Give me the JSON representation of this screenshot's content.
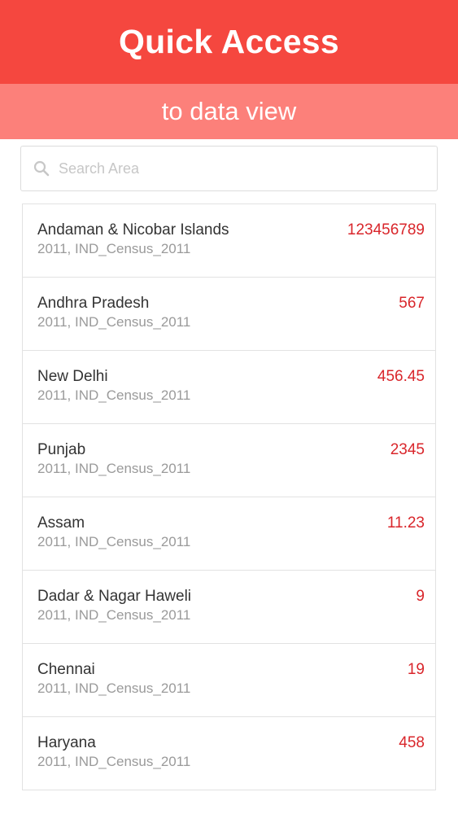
{
  "header": {
    "title": "Quick Access",
    "subtitle": "to data view"
  },
  "search": {
    "placeholder": "Search Area",
    "value": ""
  },
  "items": [
    {
      "name": "Andaman & Nicobar Islands",
      "meta": "2011, IND_Census_2011",
      "value": "123456789"
    },
    {
      "name": "Andhra Pradesh",
      "meta": "2011, IND_Census_2011",
      "value": "567"
    },
    {
      "name": "New Delhi",
      "meta": "2011, IND_Census_2011",
      "value": "456.45"
    },
    {
      "name": "Punjab",
      "meta": "2011, IND_Census_2011",
      "value": "2345"
    },
    {
      "name": "Assam",
      "meta": "2011, IND_Census_2011",
      "value": "11.23"
    },
    {
      "name": "Dadar & Nagar Haweli",
      "meta": "2011, IND_Census_2011",
      "value": "9"
    },
    {
      "name": "Chennai",
      "meta": "2011, IND_Census_2011",
      "value": "19"
    },
    {
      "name": "Haryana",
      "meta": "2011, IND_Census_2011",
      "value": "458"
    }
  ],
  "colors": {
    "header": "#f5473f",
    "subheader": "#fc807a",
    "value": "#d9262b"
  },
  "icons": {
    "search": "search-icon"
  }
}
